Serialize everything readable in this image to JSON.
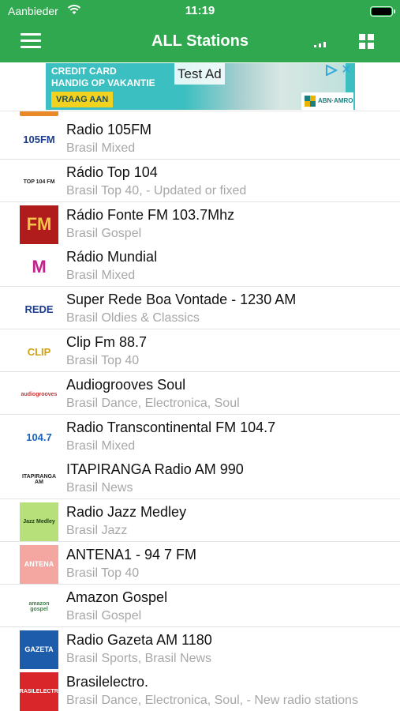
{
  "status_bar": {
    "carrier": "Aanbieder",
    "time": "11:19"
  },
  "nav": {
    "title": "ALL Stations"
  },
  "ad": {
    "line1": "CREDIT CARD",
    "line2": "HANDIG OP VAKANTIE",
    "cta": "VRAAG AAN",
    "badge": "Test Ad",
    "close": "✕",
    "bank": "ABN·AMRO"
  },
  "stations": [
    {
      "name": "Radio 105FM",
      "genre": "Brasil Mixed",
      "logo_text": "105FM",
      "logo_bg": "#ffffff",
      "logo_color": "#1c3c8c"
    },
    {
      "name": "Rádio Top 104",
      "genre": "Brasil Top 40, - Updated or fixed",
      "logo_text": "TOP 104 FM",
      "logo_bg": "#ffffff",
      "logo_color": "#222222"
    },
    {
      "name": "Rádio Fonte FM 103.7Mhz",
      "genre": "Brasil Gospel",
      "logo_text": "FM",
      "logo_bg": "#b01c1c",
      "logo_color": "#f5c24a"
    },
    {
      "name": "Rádio Mundial",
      "genre": "Brasil Mixed",
      "logo_text": "M",
      "logo_bg": "#ffffff",
      "logo_color": "#c2228a"
    },
    {
      "name": "Super Rede Boa Vontade - 1230 AM",
      "genre": "Brasil Oldies & Classics",
      "logo_text": "REDE",
      "logo_bg": "#ffffff",
      "logo_color": "#1c3c8c"
    },
    {
      "name": "Clip Fm 88.7",
      "genre": "Brasil Top 40",
      "logo_text": "CLIP",
      "logo_bg": "#ffffff",
      "logo_color": "#d2a010"
    },
    {
      "name": "Audiogrooves Soul",
      "genre": "Brasil Dance, Electronica, Soul",
      "logo_text": "audiogrooves",
      "logo_bg": "#ffffff",
      "logo_color": "#d03030"
    },
    {
      "name": "Radio Transcontinental FM 104.7",
      "genre": "Brasil Mixed",
      "logo_text": "104.7",
      "logo_bg": "#ffffff",
      "logo_color": "#1a63b8"
    },
    {
      "name": "ITAPIRANGA Radio AM 990",
      "genre": "Brasil News",
      "logo_text": "ITAPIRANGA AM",
      "logo_bg": "#ffffff",
      "logo_color": "#222222"
    },
    {
      "name": "Radio Jazz Medley",
      "genre": "Brasil Jazz",
      "logo_text": "Jazz Medley",
      "logo_bg": "#b7e07a",
      "logo_color": "#1e3c10"
    },
    {
      "name": "ANTENA1 - 94 7 FM",
      "genre": "Brasil Top 40",
      "logo_text": "ANTENA",
      "logo_bg": "#f4a6a0",
      "logo_color": "#ffffff"
    },
    {
      "name": "Amazon Gospel",
      "genre": "Brasil Gospel",
      "logo_text": "amazon gospel",
      "logo_bg": "#ffffff",
      "logo_color": "#2e8a3e"
    },
    {
      "name": "Radio Gazeta AM 1180",
      "genre": "Brasil Sports, Brasil News",
      "logo_text": "GAZETA",
      "logo_bg": "#1d5cab",
      "logo_color": "#ffffff"
    },
    {
      "name": "Brasilelectro.",
      "genre": "Brasil Dance, Electronica, Soul, - New radio stations",
      "logo_text": "BRASILELECTRO",
      "logo_bg": "#d8262a",
      "logo_color": "#ffffff"
    }
  ]
}
